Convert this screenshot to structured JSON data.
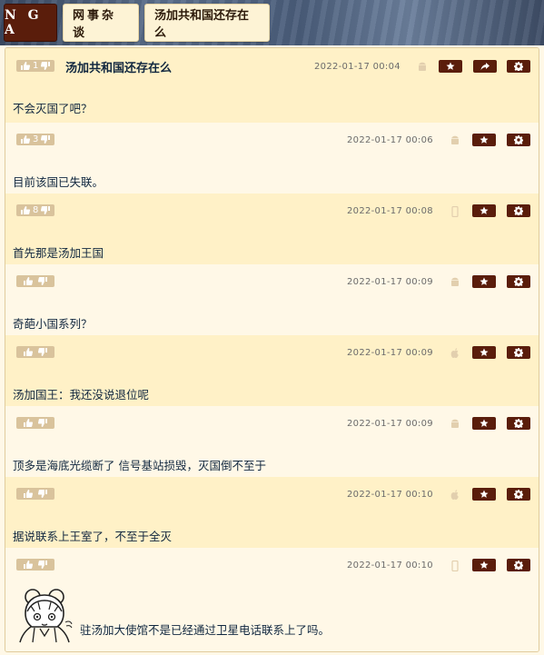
{
  "nav": {
    "logo": "N G A",
    "forum": "网事杂谈",
    "topic": "汤加共和国还存在么"
  },
  "colors": {
    "accent": "#5a1d0b",
    "row_odd": "#fff1c7",
    "row_even": "#fff8e7",
    "vote_bg": "#d9c39c"
  },
  "thread": {
    "title": "汤加共和国还存在么",
    "posts": [
      {
        "votes": "1",
        "date": "2022-01-17 00:04",
        "device": "android-icon",
        "content": "不会灭国了吧？"
      },
      {
        "votes": "3",
        "date": "2022-01-17 00:06",
        "device": "android-icon",
        "content": "目前该国已失联。"
      },
      {
        "votes": "8",
        "date": "2022-01-17 00:08",
        "device": "phone-icon",
        "content": "首先那是汤加王国"
      },
      {
        "votes": "",
        "date": "2022-01-17 00:09",
        "device": "android-icon",
        "content": "奇葩小国系列？"
      },
      {
        "votes": "",
        "date": "2022-01-17 00:09",
        "device": "apple-icon",
        "content": "汤加国王：我还没说退位呢"
      },
      {
        "votes": "",
        "date": "2022-01-17 00:09",
        "device": "android-icon",
        "content": "顶多是海底光缆断了 信号基站损毁，灭国倒不至于"
      },
      {
        "votes": "",
        "date": "2022-01-17 00:10",
        "device": "apple-icon",
        "content": "据说联系上王室了，不至于全灭"
      },
      {
        "votes": "",
        "date": "2022-01-17 00:10",
        "device": "phone-icon",
        "content": "驻汤加大使馆不是已经通过卫星电话联系上了吗。"
      }
    ]
  }
}
